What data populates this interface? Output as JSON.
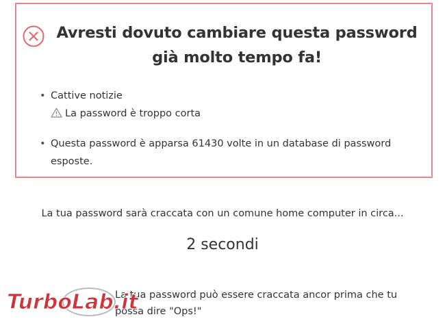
{
  "alert": {
    "title": "Avresti dovuto cambiare questa password già molto tempo fa!",
    "items": [
      {
        "label": "Cattive notizie",
        "warning": "La password è troppo corta"
      },
      {
        "label": "Questa password è apparsa 61430 volte in un database di password esposte."
      }
    ],
    "border_color": "#e8878c"
  },
  "estimate": {
    "intro": "La tua password sarà craccata con un comune home computer in circa...",
    "time": "2 secondi",
    "note": "La tua password può essere craccata ancor prima che tu possa dire \"Ops!\""
  },
  "watermark": {
    "brand_part1": "Turbo",
    "brand_part2": "Lab",
    "brand_part3": ".it"
  },
  "icons": {
    "error": "x-circle-icon",
    "warning": "warning-triangle-icon"
  }
}
